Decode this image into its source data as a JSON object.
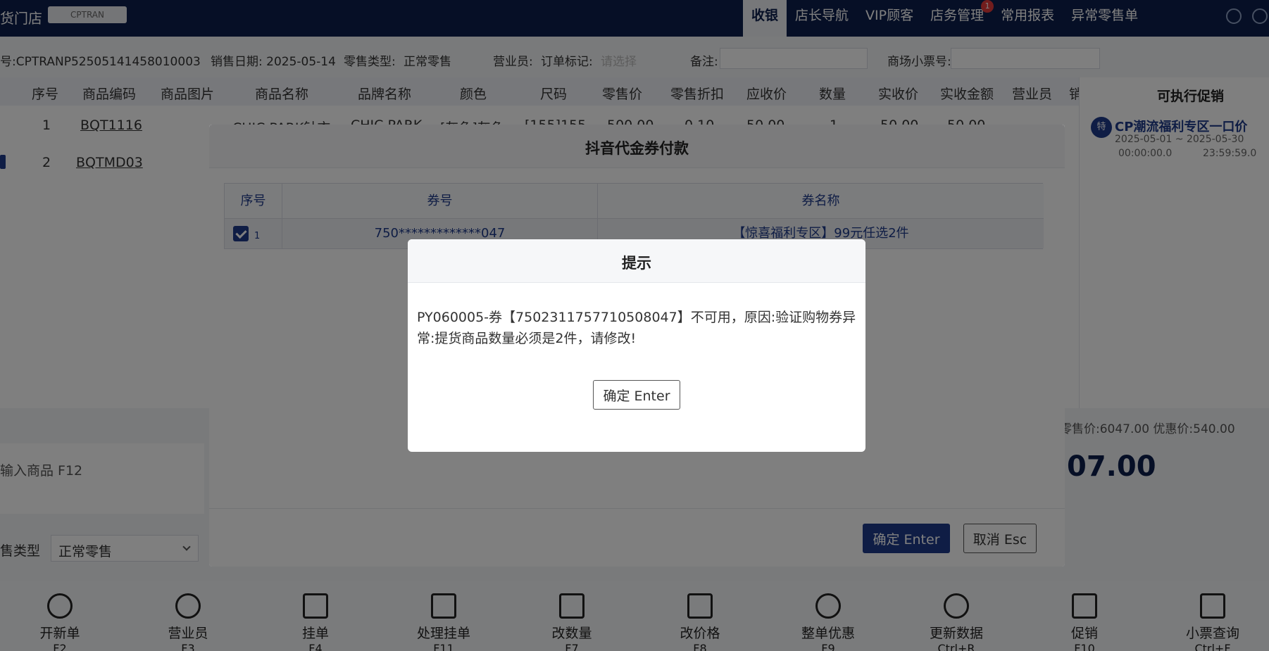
{
  "topbar": {
    "store_name": "货门店",
    "store_code": "CPTRAN",
    "nav": [
      {
        "label": "收银"
      },
      {
        "label": "店长导航"
      },
      {
        "label": "VIP顾客"
      },
      {
        "label": "店务管理",
        "badge": "1"
      },
      {
        "label": "常用报表"
      },
      {
        "label": "异常零售单"
      }
    ]
  },
  "info": {
    "order_no": "号:CPTRANP52505141458010003",
    "sale_date": "销售日期: 2025-05-14",
    "retail_type_label": "零售类型:",
    "retail_type_value": "正常零售",
    "salesperson_label": "营业员:",
    "order_mark_label": "订单标记:",
    "order_mark_value": "请选择",
    "note_label": "备注:",
    "mall_ticket_label": "商场小票号:"
  },
  "table": {
    "headers": [
      "序号",
      "商品编码",
      "商品图片",
      "商品名称",
      "品牌名称",
      "颜色",
      "尺码",
      "零售价",
      "零售折扣",
      "应收价",
      "数量",
      "实收价",
      "实收金额",
      "营业员",
      "销"
    ],
    "rows": [
      {
        "no": "1",
        "code": "BQT1116",
        "name": "CHIC PARK针衣",
        "brand": "CHIC PARK",
        "color": "[灰色]灰色",
        "size": "[155]155",
        "price": "500.00",
        "discount": "0.10",
        "due": "50.00",
        "qty": "1",
        "paid": "50.00",
        "amount": "50.00"
      },
      {
        "no": "2",
        "code": "BQTMD03"
      }
    ]
  },
  "promo": {
    "title": "可执行促销",
    "badge": "特",
    "name": "CP潮流福利专区一口价",
    "date": "2025-05-01 ~ 2025-05-30",
    "time_start": "00:00:00.0",
    "time_end": "23:59:59.0"
  },
  "lower": {
    "scan_placeholder": "输入商品 F12",
    "sale_type_label": "售类型",
    "sale_type_value": "正常零售",
    "totals": "零售价:6047.00   优惠价:540.00",
    "big_total": "07.00"
  },
  "toolbar": [
    {
      "label": "开新单",
      "key": "F2"
    },
    {
      "label": "营业员",
      "key": "F3"
    },
    {
      "label": "挂单",
      "key": "F4"
    },
    {
      "label": "处理挂单",
      "key": "F11"
    },
    {
      "label": "改数量",
      "key": "F7"
    },
    {
      "label": "改价格",
      "key": "F8"
    },
    {
      "label": "整单优惠",
      "key": "F9"
    },
    {
      "label": "更新数据",
      "key": "Ctrl+R"
    },
    {
      "label": "促销",
      "key": "F10"
    },
    {
      "label": "小票查询",
      "key": "Ctrl+F"
    }
  ],
  "coupon_dialog": {
    "title": "抖音代金券付款",
    "headers": [
      "序号",
      "券号",
      "券名称"
    ],
    "row": {
      "no": "1",
      "code": "750*************047",
      "name": "【惊喜福利专区】99元任选2件"
    },
    "ok_label": "确定 Enter",
    "cancel_label": "取消 Esc"
  },
  "alert": {
    "title": "提示",
    "message": "PY060005-券【7502311757710508047】不可用，原因:验证购物券异常:提货商品数量必须是2件，请修改!",
    "ok_label": "确定 Enter"
  }
}
